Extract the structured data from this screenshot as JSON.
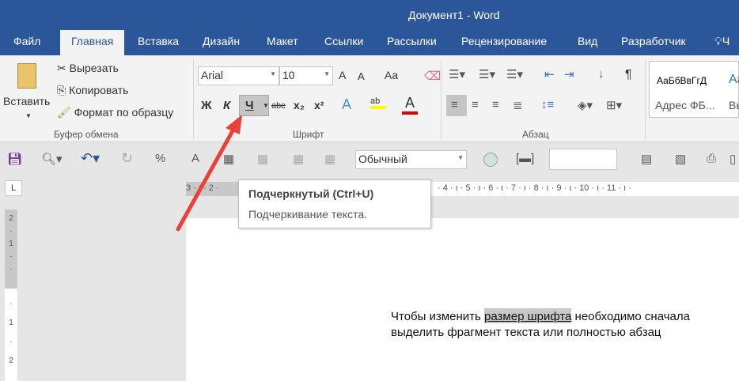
{
  "window": {
    "title": "Документ1 - Word"
  },
  "tabs": [
    "Файл",
    "Главная",
    "Вставка",
    "Дизайн",
    "Макет",
    "Ссылки",
    "Рассылки",
    "Рецензирование",
    "Вид",
    "Разработчик"
  ],
  "tell_me": "Ч",
  "clipboard": {
    "paste": "Вставить",
    "cut": "Вырезать",
    "copy": "Копировать",
    "format_painter": "Формат по образцу",
    "label": "Буфер обмена"
  },
  "font": {
    "name": "Arial",
    "size": "10",
    "bold": "Ж",
    "italic": "К",
    "underline": "Ч",
    "strike": "abc",
    "sub": "x₂",
    "sup": "x²",
    "case": "Aa",
    "grow": "A",
    "shrink": "A",
    "effects": "A",
    "highlight": "ab",
    "color": "A",
    "label": "Шрифт"
  },
  "paragraph": {
    "label": "Абзац",
    "pilcrow": "¶"
  },
  "styles": {
    "sample": "АаБбВвГгД",
    "sample2": "Aa",
    "item1": "Адрес ФБ...",
    "item2": "Вь"
  },
  "qat": {
    "style_value": "Обычный"
  },
  "ruler": {
    "left_marks": "3 · ı · 2 ·",
    "right_marks": "· 4 · ı · 5 · ı · 6 · ı · 7 · ı · 8 · ı · 9 · ı · 10 · ı · 11 · ı ·",
    "tab_selector": "L"
  },
  "vruler": [
    "2",
    "·",
    "1",
    "·",
    "·",
    "·",
    "1",
    "·",
    "2"
  ],
  "tooltip": {
    "title": "Подчеркнутый (Ctrl+U)",
    "description": "Подчеркивание текста."
  },
  "document": {
    "line1_before": "Чтобы изменить ",
    "line1_selected": "размер шрифта",
    "line1_after": " необходимо сначала",
    "line2": "выделить фрагмент текста или полностью абзац"
  },
  "colors": {
    "accent": "#2b579a",
    "arrow": "#e8413a",
    "highlight": "#ffff00",
    "font_color": "#e00000"
  }
}
